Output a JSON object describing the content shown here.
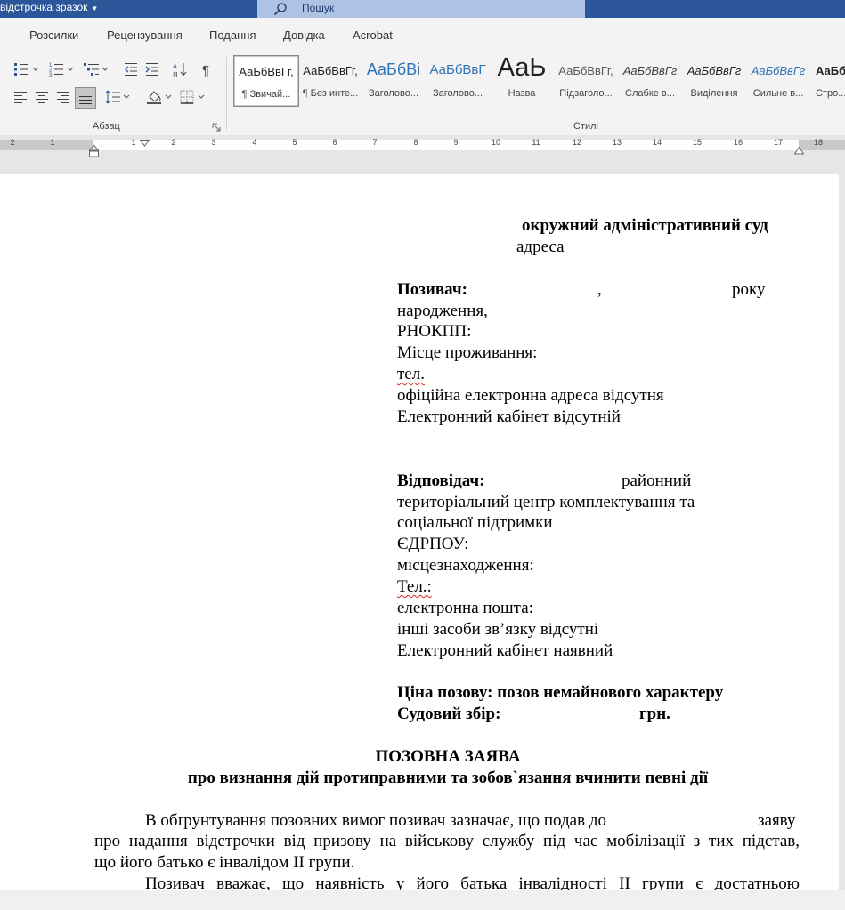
{
  "titlebar": {
    "doc_title": "відстрочка зразок",
    "search_placeholder": "Пошук",
    "accent": "#2b579a"
  },
  "menu": {
    "tabs": [
      "Розсилки",
      "Рецензування",
      "Подання",
      "Довідка",
      "Acrobat"
    ]
  },
  "ribbon": {
    "paragraph_group_label": "Абзац",
    "styles_group_label": "Стилі",
    "icons": [
      "bullets-icon",
      "numbering-icon",
      "multilevel-list-icon",
      "decrease-indent-icon",
      "increase-indent-icon",
      "sort-icon",
      "show-formatting-icon",
      "align-left-icon",
      "align-center-icon",
      "align-right-icon",
      "justify-icon",
      "line-spacing-icon",
      "shading-icon",
      "borders-icon"
    ],
    "styles": [
      {
        "sample": "АаБбВвГг,",
        "name": "¶ Звичай..."
      },
      {
        "sample": "АаБбВвГг,",
        "name": "¶ Без инте..."
      },
      {
        "sample": "АаБбВі",
        "name": "Заголово..."
      },
      {
        "sample": "АаБбВвГ",
        "name": "Заголово..."
      },
      {
        "sample": "АаЬ",
        "name": "Назва"
      },
      {
        "sample": "АаБбВвГг,",
        "name": "Підзаголо..."
      },
      {
        "sample": "АаБбВвГг",
        "name": "Слабке в..."
      },
      {
        "sample": "АаБбВвГг",
        "name": "Виділення"
      },
      {
        "sample": "АаБбВвГг",
        "name": "Сильне в..."
      },
      {
        "sample": "АаБб",
        "name": "Стро..."
      }
    ]
  },
  "ruler": {
    "numbers": [
      "2",
      "1",
      "1",
      "2",
      "3",
      "4",
      "5",
      "6",
      "7",
      "8",
      "9",
      "10",
      "11",
      "12",
      "13",
      "14",
      "15",
      "16",
      "17",
      "18"
    ]
  },
  "document": {
    "court": "окружний адміністративний суд",
    "court_address": "адреса",
    "plaintiff_label": "Позивач:",
    "plaintiff_comma": ",",
    "plaintiff_year": "року",
    "plaintiff_birth": "народження,",
    "plaintiff_rnokpp": "РНОКПП:",
    "plaintiff_residence": "Місце проживання:",
    "plaintiff_tel": "тел.",
    "plaintiff_email": "офіційна електронна адреса відсутня",
    "plaintiff_cabinet": "Електронний кабінет відсутній",
    "defendant_label": "Відповідач:",
    "defendant_district": "районний",
    "defendant_name_1": "територіальний центр комплектування та",
    "defendant_name_2": "соціальної підтримки",
    "defendant_edrpou": "ЄДРПОУ:",
    "defendant_location": "місцезнаходження:",
    "defendant_tel": "Тел.:",
    "defendant_email": "електронна пошта:",
    "defendant_other": "інші засоби зв’язку відсутні",
    "defendant_cabinet": "Електронний кабінет наявний",
    "claim_price": "Ціна позову: позов немайнового характеру",
    "court_fee_label": "Судовий збір:",
    "court_fee_currency": "грн.",
    "heading": "ПОЗОВНА ЗАЯВА",
    "subheading": "про визнання дій протиправними та зобов`язання вчинити певні дії",
    "para1_start": "В обґрунтування позовних вимог позивач зазначає, що подав до",
    "para1_end": "заяву",
    "para1_line2": "про надання відстрочки від призову на військову службу під час мобілізації з тих підстав,",
    "para1_line3": "що його батько є інвалідом ІІ групи.",
    "para2_line1": "Позивач вважає, що наявність у його батька інвалідності ІІ групи є достатньою"
  }
}
